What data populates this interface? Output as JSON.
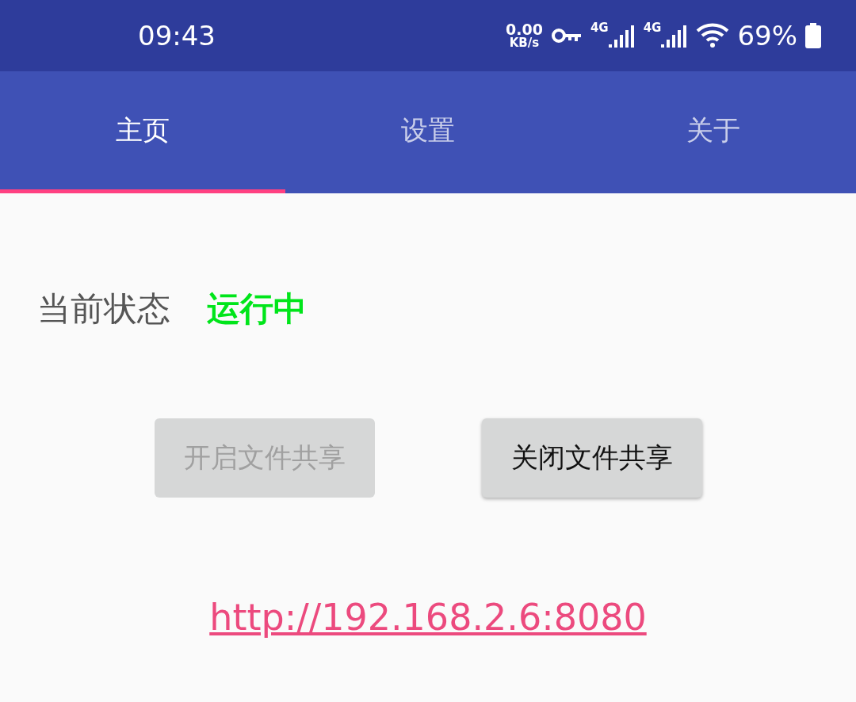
{
  "status_bar": {
    "time": "09:43",
    "net_speed": "0.00",
    "net_unit": "KB/s",
    "networks": [
      {
        "label": "4G"
      },
      {
        "label": "4G"
      }
    ],
    "battery": "69%"
  },
  "tabs": [
    {
      "label": "主页",
      "selected": true
    },
    {
      "label": "设置",
      "selected": false
    },
    {
      "label": "关于",
      "selected": false
    }
  ],
  "status": {
    "label": "当前状态",
    "value": "运行中"
  },
  "buttons": [
    {
      "label": "开启文件共享",
      "disabled": true
    },
    {
      "label": "关闭文件共享",
      "disabled": false
    }
  ],
  "link": "http://192.168.2.6:8080"
}
